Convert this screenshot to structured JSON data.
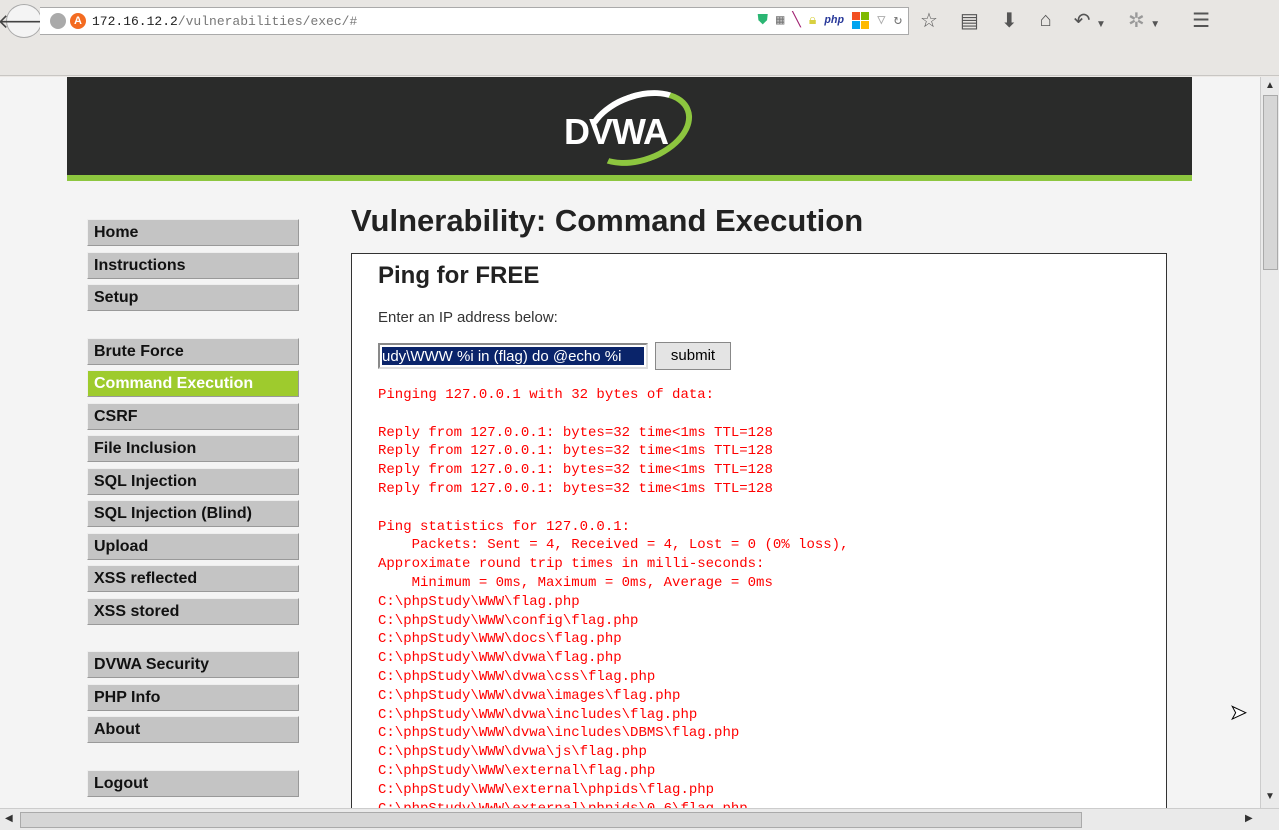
{
  "browser": {
    "url_host": "172.16.12.2",
    "url_path": "/vulnerabilities/exec/#"
  },
  "header": {
    "logo": "DVWA"
  },
  "menu": {
    "group1": [
      "Home",
      "Instructions",
      "Setup"
    ],
    "group2": [
      "Brute Force",
      "Command Execution",
      "CSRF",
      "File Inclusion",
      "SQL Injection",
      "SQL Injection (Blind)",
      "Upload",
      "XSS reflected",
      "XSS stored"
    ],
    "group3": [
      "DVWA Security",
      "PHP Info",
      "About"
    ],
    "group4": [
      "Logout"
    ],
    "active": "Command Execution"
  },
  "main": {
    "title": "Vulnerability: Command Execution",
    "box_title": "Ping for FREE",
    "label": "Enter an IP address below:",
    "input_value": "udy\\WWW %i in (flag)  do @echo %i",
    "submit": "submit",
    "output": "Pinging 127.0.0.1 with 32 bytes of data:\n\nReply from 127.0.0.1: bytes=32 time<1ms TTL=128\nReply from 127.0.0.1: bytes=32 time<1ms TTL=128\nReply from 127.0.0.1: bytes=32 time<1ms TTL=128\nReply from 127.0.0.1: bytes=32 time<1ms TTL=128\n\nPing statistics for 127.0.0.1:\n    Packets: Sent = 4, Received = 4, Lost = 0 (0% loss),\nApproximate round trip times in milli-seconds:\n    Minimum = 0ms, Maximum = 0ms, Average = 0ms\nC:\\phpStudy\\WWW\\flag.php\nC:\\phpStudy\\WWW\\config\\flag.php\nC:\\phpStudy\\WWW\\docs\\flag.php\nC:\\phpStudy\\WWW\\dvwa\\flag.php\nC:\\phpStudy\\WWW\\dvwa\\css\\flag.php\nC:\\phpStudy\\WWW\\dvwa\\images\\flag.php\nC:\\phpStudy\\WWW\\dvwa\\includes\\flag.php\nC:\\phpStudy\\WWW\\dvwa\\includes\\DBMS\\flag.php\nC:\\phpStudy\\WWW\\dvwa\\js\\flag.php\nC:\\phpStudy\\WWW\\external\\flag.php\nC:\\phpStudy\\WWW\\external\\phpids\\flag.php\nC:\\phpStudy\\WWW\\external\\phpids\\0.6\\flag.php"
  }
}
